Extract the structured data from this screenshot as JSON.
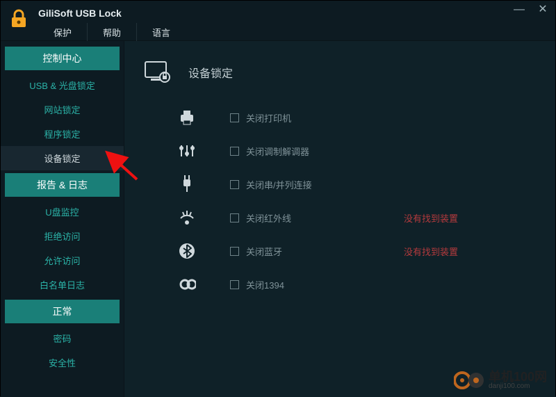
{
  "app": {
    "title": "GiliSoft USB Lock",
    "menu": [
      "保护",
      "帮助",
      "语言"
    ]
  },
  "sidebar": {
    "sections": [
      {
        "header": "控制中心",
        "items": [
          {
            "label": "USB & 光盘锁定",
            "selected": false
          },
          {
            "label": "网站锁定",
            "selected": false
          },
          {
            "label": "程序锁定",
            "selected": false
          },
          {
            "label": "设备锁定",
            "selected": true
          }
        ]
      },
      {
        "header": "报告 & 日志",
        "items": [
          {
            "label": "U盘监控",
            "selected": false
          },
          {
            "label": "拒绝访问",
            "selected": false
          },
          {
            "label": "允许访问",
            "selected": false
          },
          {
            "label": "白名单日志",
            "selected": false
          }
        ]
      },
      {
        "header": "正常",
        "items": [
          {
            "label": "密码",
            "selected": false
          },
          {
            "label": "安全性",
            "selected": false
          }
        ]
      }
    ]
  },
  "content": {
    "title": "设备锁定",
    "options": [
      {
        "icon": "printer",
        "label": "关闭打印机",
        "warn": ""
      },
      {
        "icon": "modem",
        "label": "关闭调制解调器",
        "warn": ""
      },
      {
        "icon": "serial",
        "label": "关闭串/并列连接",
        "warn": ""
      },
      {
        "icon": "infrared",
        "label": "关闭红外线",
        "warn": "没有找到装置"
      },
      {
        "icon": "bluetooth",
        "label": "关闭蓝牙",
        "warn": "没有找到装置"
      },
      {
        "icon": "1394",
        "label": "关闭1394",
        "warn": ""
      }
    ]
  },
  "watermark": {
    "main": "单机100网",
    "sub": "danji100.com"
  }
}
